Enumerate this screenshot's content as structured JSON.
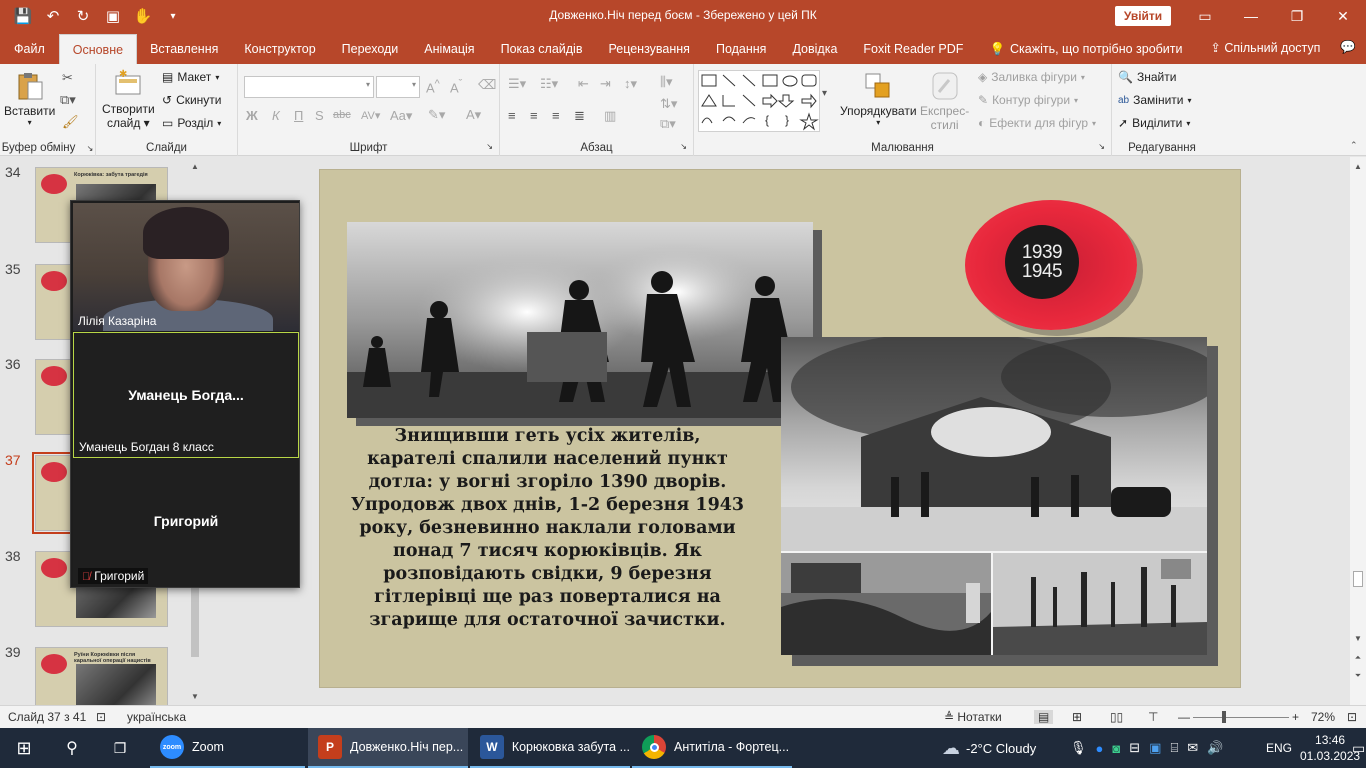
{
  "window": {
    "title": "Довженко.Ніч перед боєм  -  Збережено у цей ПК",
    "signin_label": "Увійти"
  },
  "ribbon_tabs": [
    "Файл",
    "Основне",
    "Вставлення",
    "Конструктор",
    "Переходи",
    "Анімація",
    "Показ слайдів",
    "Рецензування",
    "Подання",
    "Довідка",
    "Foxit Reader PDF"
  ],
  "tell_me": "Скажіть, що потрібно зробити",
  "share_label": "Спільний доступ",
  "ribbon": {
    "clipboard": {
      "paste": "Вставити",
      "group": "Буфер обміну"
    },
    "slides": {
      "new_slide_l1": "Створити",
      "new_slide_l2": "слайд",
      "layout": "Макет",
      "reset": "Скинути",
      "section": "Розділ",
      "group": "Слайди"
    },
    "font": {
      "group": "Шрифт"
    },
    "paragraph": {
      "group": "Абзац"
    },
    "drawing": {
      "arrange": "Упорядкувати",
      "quick_styles_l1": "Експрес-",
      "quick_styles_l2": "стилі",
      "fill": "Заливка фігури",
      "outline": "Контур фігури",
      "effects": "Ефекти для фігур",
      "group": "Малювання"
    },
    "editing": {
      "find": "Знайти",
      "replace": "Замінити",
      "select": "Виділити",
      "group": "Редагування"
    }
  },
  "thumbnails": [
    {
      "number": "34",
      "title": "Корюківка: забута трагедія"
    },
    {
      "number": "35",
      "title": ""
    },
    {
      "number": "36",
      "title": ""
    },
    {
      "number": "37",
      "title": "",
      "active": true
    },
    {
      "number": "38",
      "title": ""
    },
    {
      "number": "39",
      "title": "Руїни Корюківки після каральної операції нацистів"
    }
  ],
  "zoom_overlay": {
    "tile1_caption": "Лілія Казаріна",
    "tile2_name": "Уманець  Богда...",
    "tile2_caption": "Уманець Богдан 8 класс",
    "tile3_name": "Григорий",
    "tile3_caption": "Григорий"
  },
  "slide": {
    "badge_line1": "1939",
    "badge_line2": "1945",
    "body_text": "Знищивши геть усіх жителів, карателі спалили населений пункт дотла: у вогні згоріло 1390 дворів.  Упродовж двох днів, 1-2 березня 1943 року, безневинно наклали головами понад 7 тисяч корюківців. Як розповідають свідки, 9 березня гітлерівці ще раз поверталися на згарище для остаточної зачистки."
  },
  "statusbar": {
    "slide_counter": "Слайд 37 з 41",
    "language": "українська",
    "notes": "Нотатки",
    "zoom_level": "72%"
  },
  "taskbar": {
    "apps": [
      "Zoom",
      "Довженко.Ніч пер...",
      "Корюковка забута ...",
      "Антитіла - Фортец..."
    ],
    "weather": "-2°C  Cloudy",
    "lang": "ENG",
    "time": "13:46",
    "date": "01.03.2023"
  },
  "colors": {
    "accent": "#b7472a",
    "slide_bg": "#cbc4a0",
    "poppy": "#e8283c"
  }
}
